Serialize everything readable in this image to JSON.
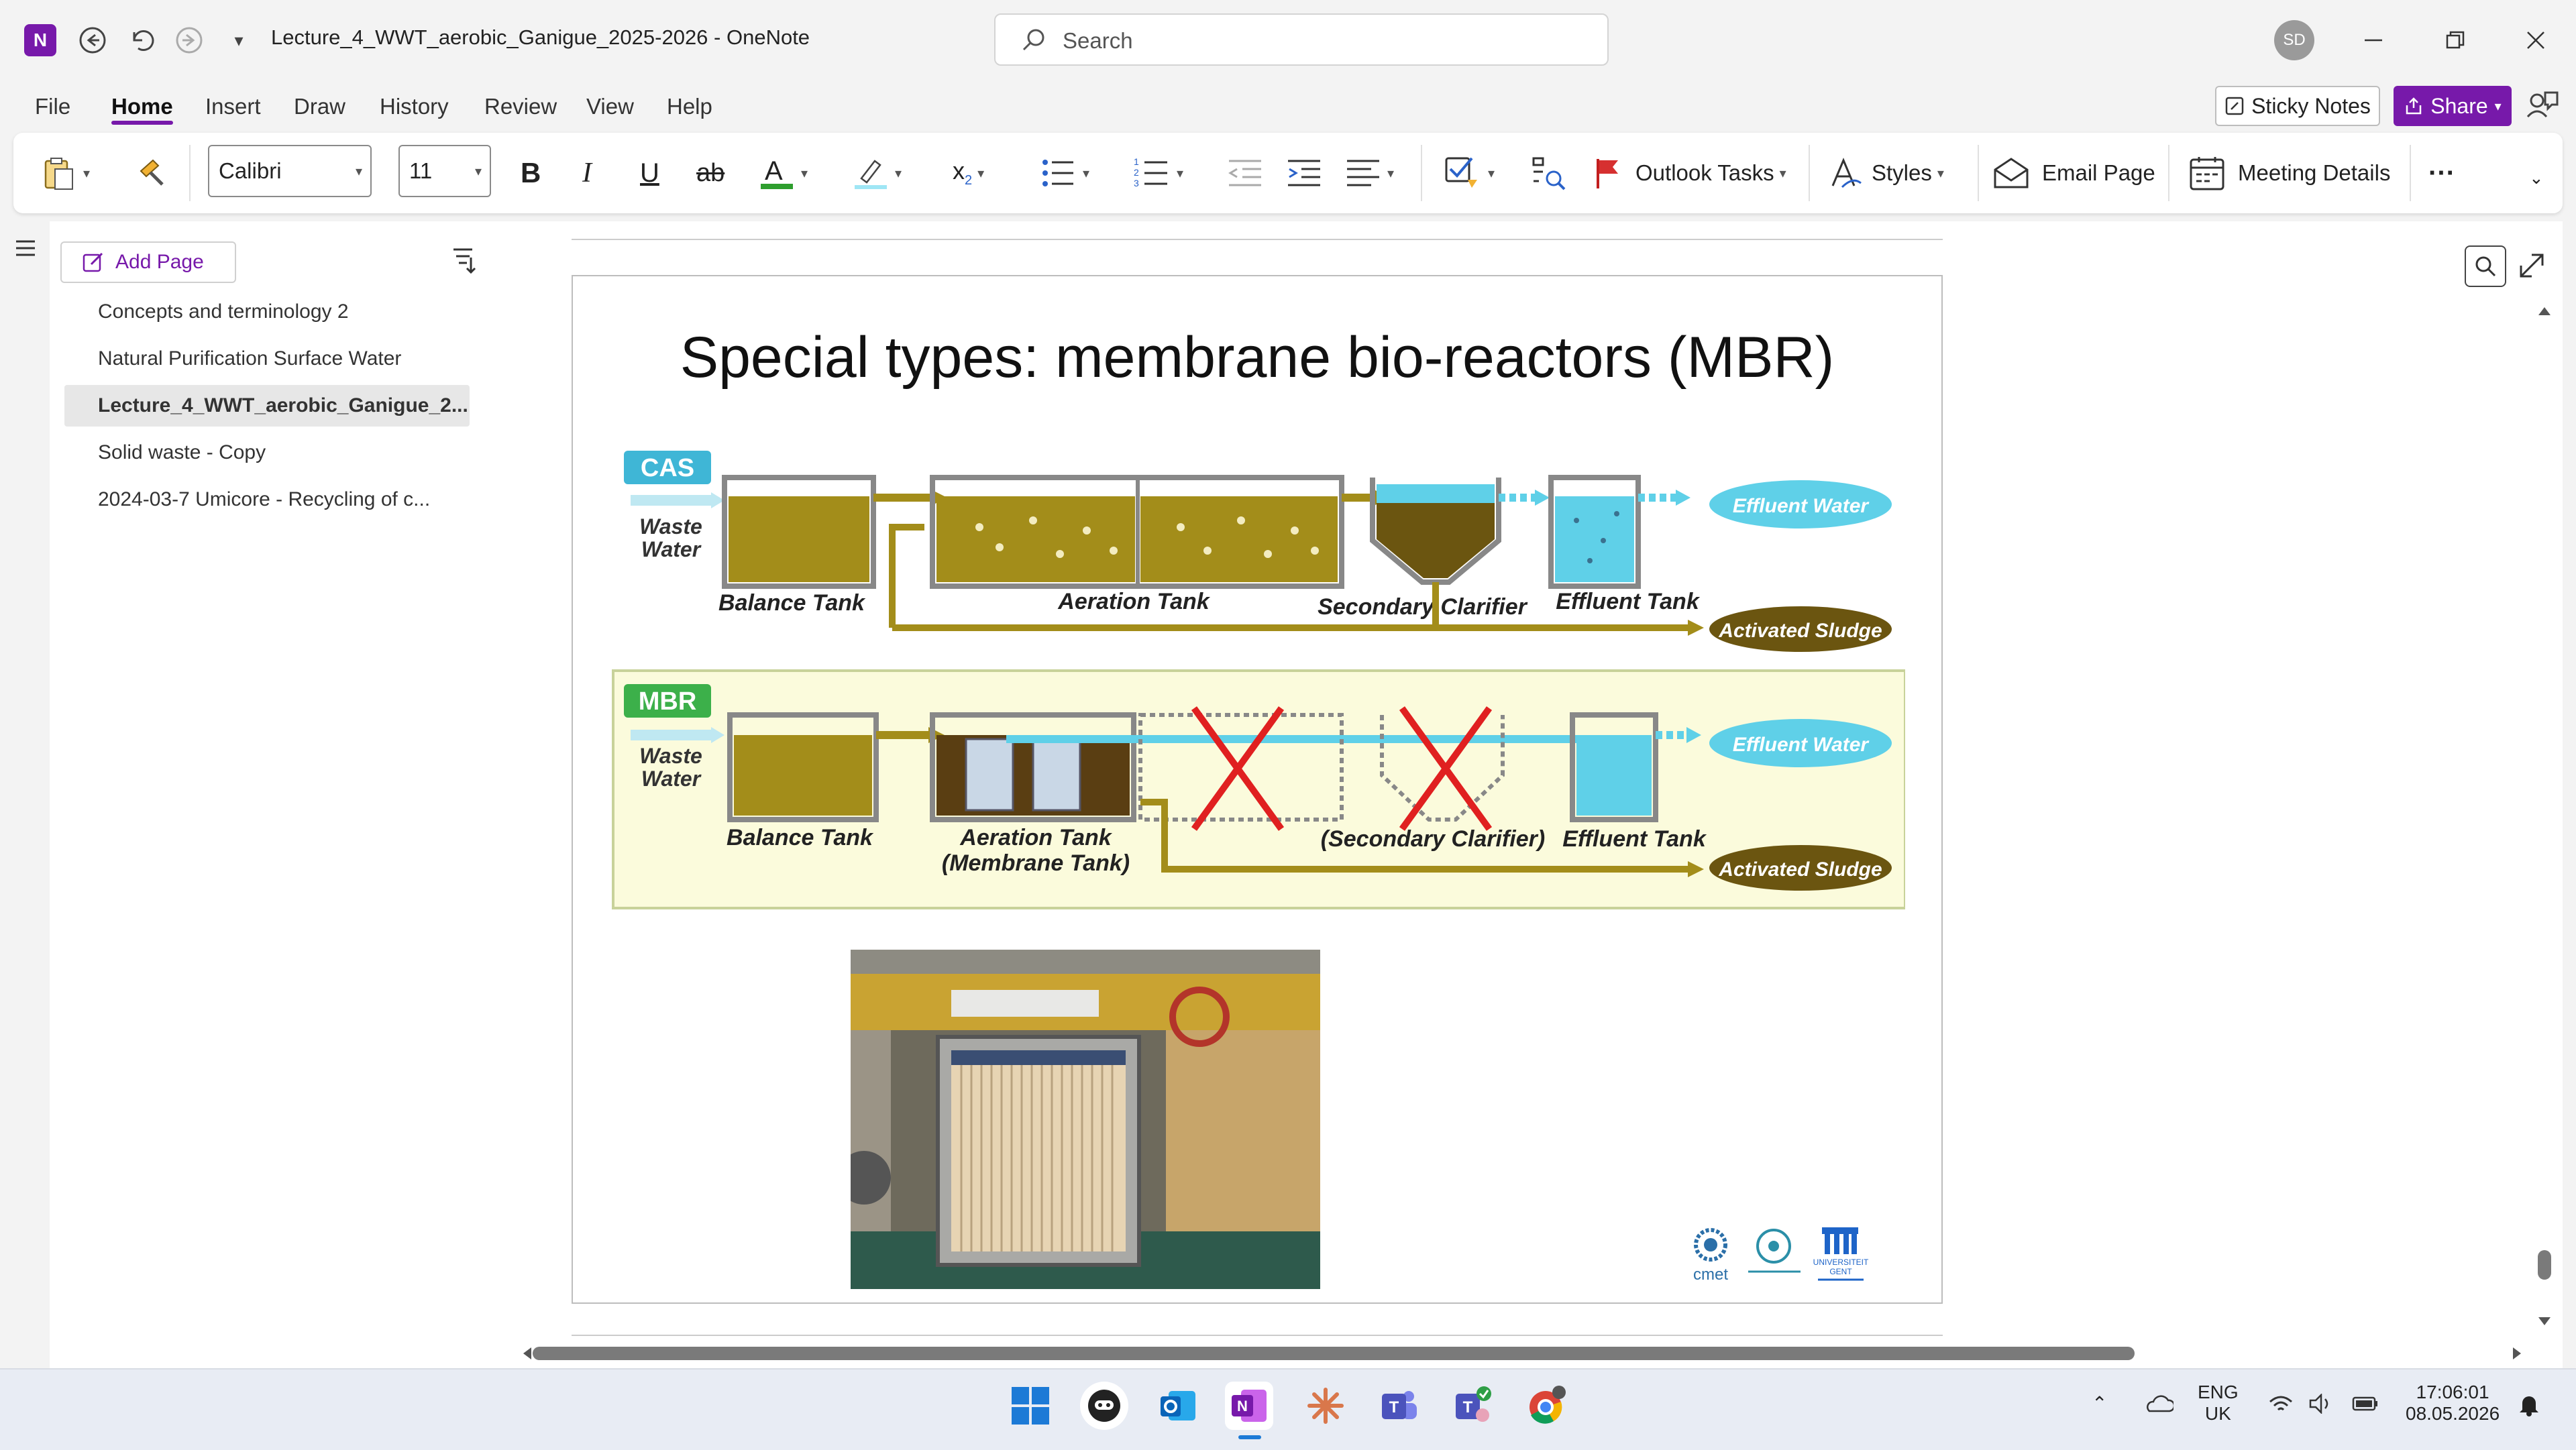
{
  "window": {
    "title": "Lecture_4_WWT_aerobic_Ganigue_2025-2026  -  OneNote",
    "app_logo": "N",
    "avatar_initials": "SD"
  },
  "search": {
    "placeholder": "Search"
  },
  "menu": {
    "items": [
      "File",
      "Home",
      "Insert",
      "Draw",
      "History",
      "Review",
      "View",
      "Help"
    ],
    "sticky_notes": "Sticky Notes",
    "share": "Share"
  },
  "ribbon": {
    "font_name": "Calibri",
    "font_size": "11",
    "outlook_tasks": "Outlook Tasks",
    "styles": "Styles",
    "email_page": "Email Page",
    "meeting_details": "Meeting Details",
    "more": "···"
  },
  "pages": {
    "add_page": "Add Page",
    "items": [
      {
        "label": "Concepts and terminology 2",
        "selected": false
      },
      {
        "label": "Natural Purification Surface Water",
        "selected": false
      },
      {
        "label": "Lecture_4_WWT_aerobic_Ganigue_2...",
        "selected": true
      },
      {
        "label": "Solid waste - Copy",
        "selected": false
      },
      {
        "label": "2024-03-7 Umicore - Recycling of c...",
        "selected": false
      }
    ]
  },
  "slide": {
    "title": "Special types: membrane bio-reactors (MBR)",
    "cas": {
      "badge": "CAS",
      "waste_water": [
        "Waste",
        "Water"
      ],
      "balance_tank": "Balance Tank",
      "aeration_tank": "Aeration Tank",
      "secondary_clarifier": "Secondary Clarifier",
      "effluent_tank": "Effluent Tank",
      "effluent_water": "Effluent Water",
      "activated_sludge": "Activated Sludge"
    },
    "mbr": {
      "badge": "MBR",
      "waste_water": [
        "Waste",
        "Water"
      ],
      "balance_tank": "Balance Tank",
      "aeration_tank": [
        "Aeration Tank",
        "(Membrane Tank)"
      ],
      "secondary_clarifier": "(Secondary Clarifier)",
      "effluent_tank": "Effluent Tank",
      "effluent_water": "Effluent Water",
      "activated_sludge": "Activated Sludge"
    },
    "logos": {
      "cmet": "cmet",
      "ugent": [
        "UNIVERSITEIT",
        "GENT"
      ]
    }
  },
  "taskbar": {
    "lang": [
      "ENG",
      "UK"
    ],
    "time": "17:06:01",
    "date": "08.05.2026"
  },
  "colors": {
    "accent": "#7719aa",
    "sludge": "#a38d1a",
    "water": "#5fd0e8"
  }
}
